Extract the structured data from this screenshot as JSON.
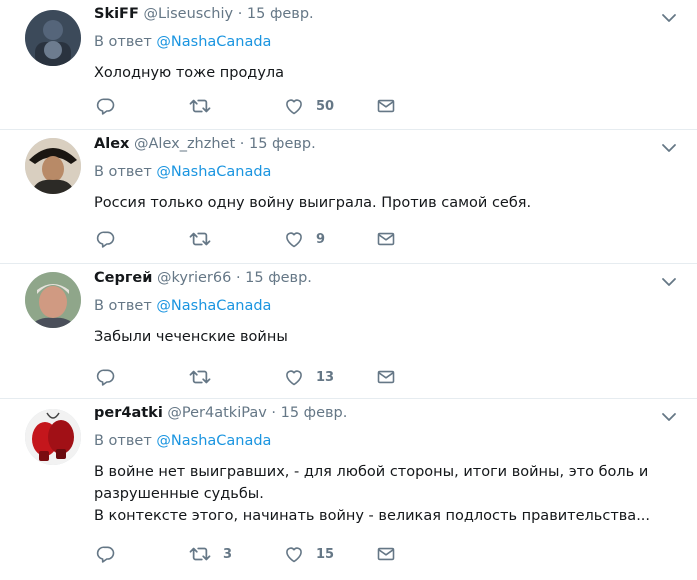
{
  "reply_prefix": "В ответ",
  "tweets": [
    {
      "name": "SkiFF",
      "handle": "@Liseuschiy",
      "date": "15 февр.",
      "reply_to": "@NashaCanada",
      "text": [
        "Холодную тоже продула"
      ],
      "retweets": "",
      "likes": "50"
    },
    {
      "name": "Alex",
      "handle": "@Alex_zhzhet",
      "date": "15 февр.",
      "reply_to": "@NashaCanada",
      "text": [
        "Россия только одну войну выиграла. Против самой себя."
      ],
      "retweets": "",
      "likes": "9"
    },
    {
      "name": "Сергей",
      "handle": "@kyrier66",
      "date": "15 февр.",
      "reply_to": "@NashaCanada",
      "text": [
        "Забыли чеченские войны"
      ],
      "retweets": "",
      "likes": "13"
    },
    {
      "name": "per4atki",
      "handle": "@Per4atkiPav",
      "date": "15 февр.",
      "reply_to": "@NashaCanada",
      "text": [
        "В войне нет выигравших, - для любой стороны, итоги войны, это боль и",
        "разрушенные судьбы.",
        "В контексте этого, начинать войну - великая подлость правительства..."
      ],
      "retweets": "3",
      "likes": "15"
    }
  ],
  "colors": {
    "text": "#14171a",
    "muted": "#657786",
    "link": "#1b95e0",
    "divider": "#e6ecf0"
  }
}
